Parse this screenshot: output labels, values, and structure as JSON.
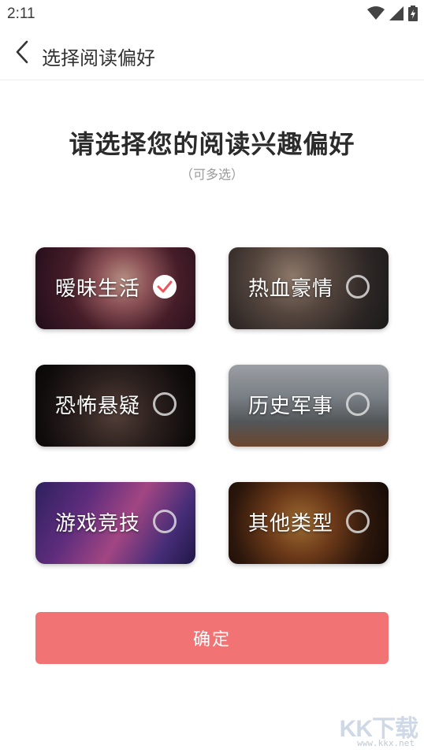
{
  "status_bar": {
    "time": "2:11",
    "icons": [
      "wifi-icon",
      "signal-icon",
      "battery-icon"
    ]
  },
  "app_bar": {
    "back_icon": "chevron-left-icon",
    "title": "选择阅读偏好"
  },
  "heading": {
    "title": "请选择您的阅读兴趣偏好",
    "subtitle": "（可多选）"
  },
  "categories": [
    {
      "label": "暧昧生活",
      "selected": true
    },
    {
      "label": "热血豪情",
      "selected": false
    },
    {
      "label": "恐怖悬疑",
      "selected": false
    },
    {
      "label": "历史军事",
      "selected": false
    },
    {
      "label": "游戏竞技",
      "selected": false
    },
    {
      "label": "其他类型",
      "selected": false
    }
  ],
  "confirm_button": {
    "label": "确定"
  },
  "watermark": {
    "logo": "KK下载",
    "url": "www.kkx.net"
  },
  "colors": {
    "accent": "#f27374",
    "check": "#f0545a"
  }
}
